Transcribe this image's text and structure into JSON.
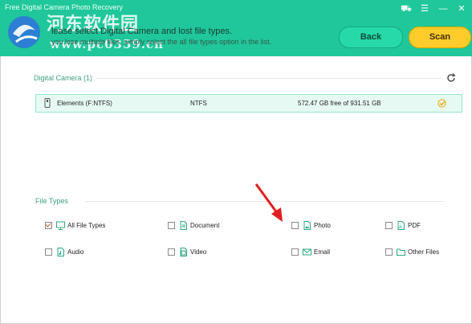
{
  "app": {
    "title": "Free Digital Camera Photo Recovery"
  },
  "window_controls": {
    "store": "⛟",
    "menu": "☰",
    "minimize": "—",
    "close": "✕"
  },
  "watermark": {
    "text": "河东软件园",
    "url": "www.pc0359.cn"
  },
  "header": {
    "instruction": "lease select Digital Camera and lost file types.",
    "sub_instruction": "you lose multiple files, simply select the all file types option in the list.",
    "back_label": "Back",
    "scan_label": "Scan"
  },
  "camera_section": {
    "title": "Digital Camera (1)",
    "drive": {
      "name": "Elements (F:NTFS)",
      "fs": "NTFS",
      "space": "572.47 GB free of 931.51 GB",
      "selected": true
    }
  },
  "file_types": {
    "title": "File Types",
    "items": [
      {
        "label": "All File Types",
        "checked": true,
        "icon": "monitor-icon"
      },
      {
        "label": "Document",
        "checked": false,
        "icon": "document-icon"
      },
      {
        "label": "Photo",
        "checked": false,
        "icon": "photo-icon"
      },
      {
        "label": "PDF",
        "checked": false,
        "icon": "pdf-icon"
      },
      {
        "label": "Audio",
        "checked": false,
        "icon": "audio-icon"
      },
      {
        "label": "Video",
        "checked": false,
        "icon": "video-icon"
      },
      {
        "label": "Email",
        "checked": false,
        "icon": "email-icon"
      },
      {
        "label": "Other Files",
        "checked": false,
        "icon": "folder-icon"
      }
    ]
  },
  "colors": {
    "header": "#1fc79a",
    "scan": "#ffcc2a",
    "back": "#27d9a8",
    "arrow": "#e02020"
  }
}
